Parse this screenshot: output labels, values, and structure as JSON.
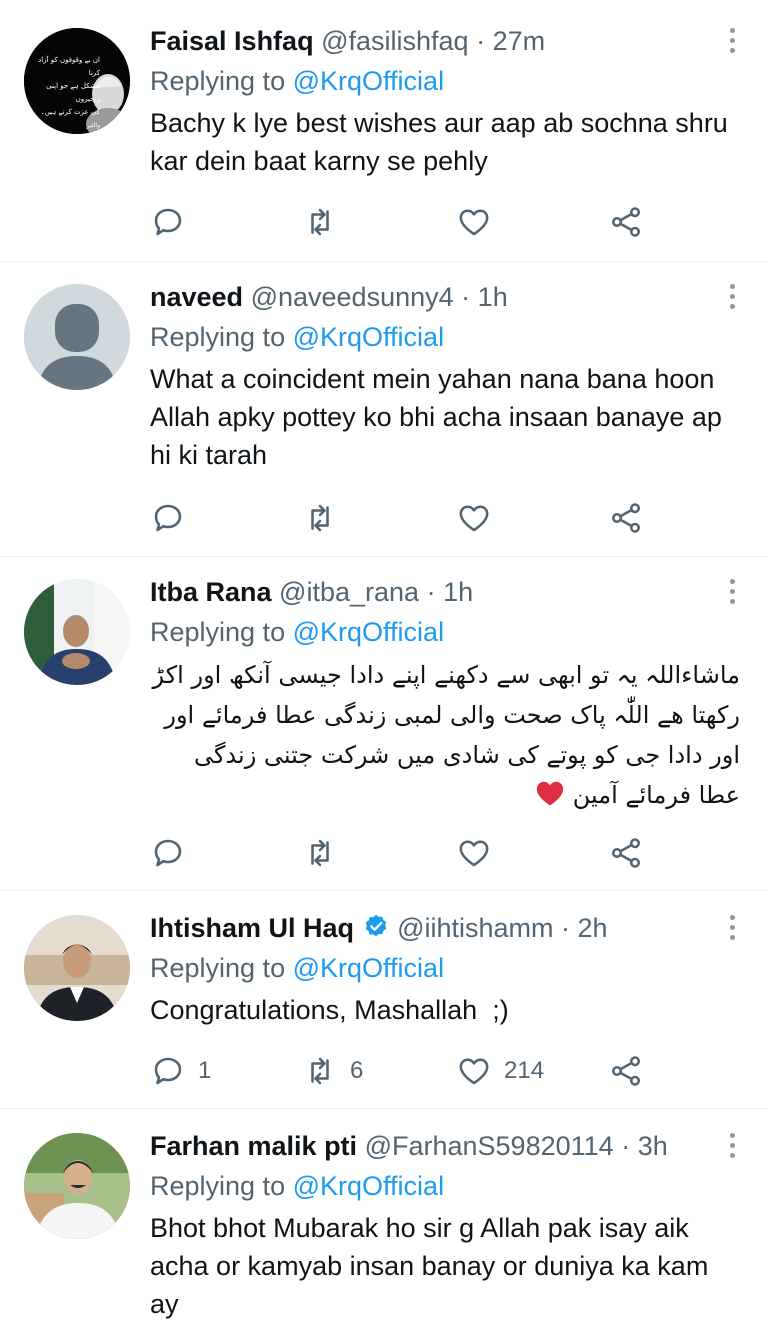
{
  "reply_prefix": "Replying to",
  "tweets": [
    {
      "name": "Faisal Ishfaq",
      "handle": "@fasilishfaq",
      "time": "27m",
      "replying_to": "@KrqOfficial",
      "text": "Bachy k lye best wishes aur aap ab sochna shru kar dein baat karny se pehly",
      "avatar": "quote-portrait-avatar",
      "avatar_text": [
        "ان بے وقوفوں کو آزاد کرنا",
        "مشکل ہے جو اپنی زنجیروں",
        "کی عزت کرتے ہیں۔",
        "والٹیر"
      ],
      "counts": {
        "reply": "",
        "retweet": "",
        "like": ""
      }
    },
    {
      "name": "naveed",
      "handle": "@naveedsunny4",
      "time": "1h",
      "replying_to": "@KrqOfficial",
      "text": "What a coincident mein yahan nana bana hoon Allah apky pottey ko bhi acha insaan banaye ap hi ki tarah",
      "avatar": "default-avatar",
      "counts": {
        "reply": "",
        "retweet": "",
        "like": ""
      }
    },
    {
      "name": "Itba Rana",
      "handle": "@itba_rana",
      "time": "1h",
      "replying_to": "@KrqOfficial",
      "text": "ماشاءاللہ یہ تو ابھی سے دکھنے اپنے دادا جیسی آنکھ اور اکڑ رکھتا ھے اللّٰہ پاک صحت والی لمبی زندگی عطا فرمائے اور اور دادا جی کو پوتے کی شادی میں شرکت جتنی زندگی عطا فرمائے آمین",
      "emoji": "red-heart",
      "avatar": "photo-avatar",
      "counts": {
        "reply": "",
        "retweet": "",
        "like": ""
      }
    },
    {
      "name": "Ihtisham Ul Haq",
      "handle": "@iihtishamm",
      "time": "2h",
      "verified": true,
      "replying_to": "@KrqOfficial",
      "text": "Congratulations, Mashallah  ;)",
      "avatar": "photo-avatar",
      "counts": {
        "reply": "1",
        "retweet": "6",
        "like": "214"
      }
    },
    {
      "name": "Farhan malik pti",
      "handle": "@FarhanS59820114",
      "time": "3h",
      "replying_to": "@KrqOfficial",
      "text": "Bhot bhot Mubarak ho sir g Allah pak isay aik acha or kamyab insan banay or duniya ka kam ay",
      "avatar": "photo-avatar",
      "counts": {
        "reply": "",
        "retweet": "",
        "like": ""
      }
    }
  ],
  "colors": {
    "link": "#1d9bf0",
    "secondary": "#536471",
    "text": "#0f1419",
    "divider": "#eff3f4",
    "verified": "#1d9bf0",
    "heart": "#e0245e"
  }
}
